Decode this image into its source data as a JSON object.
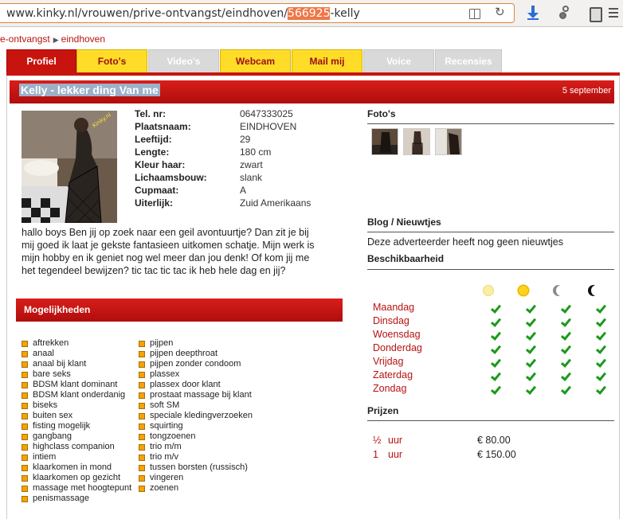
{
  "browser": {
    "url_prefix": "www.kinky.nl/vrouwen/prive-ontvangst/eindhoven/",
    "url_highlight": "566925",
    "url_suffix": "-kelly"
  },
  "breadcrumb": {
    "part1": "e-ontvangst",
    "part2": "eindhoven"
  },
  "tabs": [
    {
      "label": "Profiel",
      "state": "active"
    },
    {
      "label": "Foto's",
      "state": "enabled"
    },
    {
      "label": "Video's",
      "state": "disabled"
    },
    {
      "label": "Webcam",
      "state": "enabled"
    },
    {
      "label": "Mail mij",
      "state": "enabled"
    },
    {
      "label": "Voice",
      "state": "disabled"
    },
    {
      "label": "Recensies",
      "state": "disabled"
    }
  ],
  "colors": {
    "brand_red": "#c8140f",
    "tab_yellow": "#ffdc28",
    "tab_grey": "#d9d9d9",
    "check_green": "#1c9a1c",
    "link_red": "#b81212"
  },
  "profile": {
    "title": "Kelly - lekker ding Van me",
    "date": "5 september",
    "details": [
      {
        "label": "Tel. nr:",
        "value": "0647333025"
      },
      {
        "label": "Plaatsnaam:",
        "value": "EINDHOVEN"
      },
      {
        "label": "Leeftijd:",
        "value": "29"
      },
      {
        "label": "Lengte:",
        "value": "180 cm"
      },
      {
        "label": "Kleur haar:",
        "value": "zwart"
      },
      {
        "label": "Lichaamsbouw:",
        "value": "slank"
      },
      {
        "label": "Cupmaat:",
        "value": "A"
      },
      {
        "label": "Uiterlijk:",
        "value": "Zuid Amerikaans"
      }
    ],
    "bio": "hallo boys Ben jij op zoek naar een geil avontuurtje? Dan zit je bij mij goed ik laat je gekste fantasieen uitkomen schatje. Mijn werk is mijn hobby en ik geniet nog wel meer dan jou denk! Of kom jij me het tegendeel bewijzen? tic tac tic tac ik heb hele dag en jij?"
  },
  "mogelijkheden": {
    "title": "Mogelijkheden",
    "col1": [
      "aftrekken",
      "anaal",
      "anaal bij klant",
      "bare seks",
      "BDSM klant dominant",
      "BDSM klant onderdanig",
      "biseks",
      "buiten sex",
      "fisting mogelijk",
      "gangbang",
      "highclass companion",
      "intiem",
      "klaarkomen in mond",
      "klaarkomen op gezicht",
      "massage met hoogtepunt",
      "penismassage"
    ],
    "col2": [
      "pijpen",
      "pijpen deepthroat",
      "pijpen zonder condoom",
      "plassex",
      "plassex door klant",
      "prostaat massage bij klant",
      "soft SM",
      "speciale kledingverzoeken",
      "squirting",
      "tongzoenen",
      "trio m/m",
      "trio m/v",
      "tussen borsten (russisch)",
      "vingeren",
      "zoenen"
    ]
  },
  "fotos": {
    "title": "Foto's"
  },
  "blog": {
    "title": "Blog / Nieuwtjes",
    "text": "Deze adverteerder heeft nog geen nieuwtjes"
  },
  "beschikbaarheid": {
    "title": "Beschikbaarheid",
    "icons": [
      "morning-sun-icon",
      "afternoon-sun-icon",
      "evening-moon-icon",
      "night-moon-icon"
    ],
    "days": [
      {
        "name": "Maandag",
        "slots": [
          true,
          true,
          true,
          true
        ]
      },
      {
        "name": "Dinsdag",
        "slots": [
          true,
          true,
          true,
          true
        ]
      },
      {
        "name": "Woensdag",
        "slots": [
          true,
          true,
          true,
          true
        ]
      },
      {
        "name": "Donderdag",
        "slots": [
          true,
          true,
          true,
          true
        ]
      },
      {
        "name": "Vrijdag",
        "slots": [
          true,
          true,
          true,
          true
        ]
      },
      {
        "name": "Zaterdag",
        "slots": [
          true,
          true,
          true,
          true
        ]
      },
      {
        "name": "Zondag",
        "slots": [
          true,
          true,
          true,
          true
        ]
      }
    ]
  },
  "prijzen": {
    "title": "Prijzen",
    "rows": [
      {
        "qty": "½",
        "unit": "uur",
        "price": "€ 80.00"
      },
      {
        "qty": "1",
        "unit": "uur",
        "price": "€ 150.00"
      }
    ]
  }
}
